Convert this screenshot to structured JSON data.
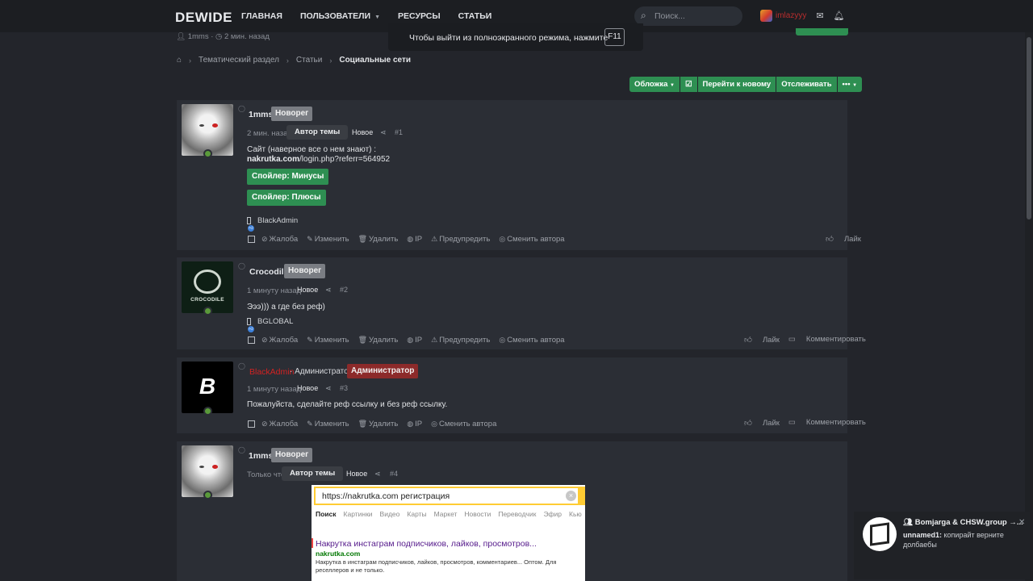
{
  "app": {
    "logo": "DEWIDE"
  },
  "nav": {
    "items": [
      "ГЛАВНАЯ",
      "ПОЛЬЗОВАТЕЛИ",
      "РЕСУРСЫ",
      "СТАТЬИ"
    ],
    "search_placeholder": "Поиск..."
  },
  "user": {
    "name": "imlazyyy"
  },
  "fullscreen_toast": {
    "text": "Чтобы выйти из полноэкранного режима, нажмите",
    "key": "F11"
  },
  "thread_meta": {
    "author": "1mms",
    "time": "2 мин. назад"
  },
  "breadcrumb": [
    "Тематический раздел",
    "Статьи",
    "Социальные сети"
  ],
  "thread_actions": [
    "Обложка",
    "☑",
    "Перейти к новому",
    "Отслеживать",
    "•••"
  ],
  "posts": [
    {
      "username": "1mms",
      "badge": "Новорег",
      "time": "2 мин. назад",
      "tooltip": "Автор темы",
      "new_label": "Новое",
      "num": "#1",
      "text1": "Сайт (наверное все о нем знают) :",
      "link_domain": "nakrutka.com",
      "link_path": "/login.php?referr=564952",
      "spoiler1": "Спойлер: Минусы",
      "spoiler2": "Спойлер: Плюсы",
      "liked_by": "BlackAdmin",
      "footer": [
        "Жалоба",
        "Изменить",
        "Удалить",
        "IP",
        "Предупредить",
        "Сменить автора"
      ],
      "right": [
        "Лайк"
      ]
    },
    {
      "username": "Crocodile",
      "badge": "Новорег",
      "avatar_label": "CROCODILE",
      "time": "1 минуту назад",
      "new_label": "Новое",
      "num": "#2",
      "text1": "Эээ))) а где без реф)",
      "liked_by": "BGLOBAL",
      "footer": [
        "Жалоба",
        "Изменить",
        "Удалить",
        "IP",
        "Предупредить",
        "Сменить автора"
      ],
      "right": [
        "Лайк",
        "Комментировать"
      ]
    },
    {
      "username": "BlackAdmin",
      "role": " · Администратор",
      "badge": "Администратор",
      "time": "1 минуту назад",
      "new_label": "Новое",
      "num": "#3",
      "text1": "Пожалуйста, сделайте реф ссылку и без реф ссылку.",
      "footer": [
        "Жалоба",
        "Изменить",
        "Удалить",
        "IP",
        "Сменить автора"
      ],
      "right": [
        "Лайк",
        "Комментировать"
      ]
    },
    {
      "username": "1mms",
      "badge": "Новорег",
      "time": "Только что",
      "tooltip": "Автор темы",
      "new_label": "Новое",
      "num": "#4"
    }
  ],
  "embedded_search": {
    "query": "https://nakrutka.com регистрация",
    "tabs": [
      "Поиск",
      "Картинки",
      "Видео",
      "Карты",
      "Маркет",
      "Новости",
      "Переводчик",
      "Эфир",
      "Кью"
    ],
    "result_title": "Накрутка инстаграм подписчиков, лайков, просмотров...",
    "result_url": "nakrutka.com",
    "result_desc": "Накрутка в инстаграм подписчиков, лайков, просмотров, комментариев... Оптом. Для реселлеров и не только."
  },
  "notification": {
    "title": "Bomjarga & CHSW.group →...",
    "sender": "unnamed1:",
    "message": " копирайт верните долбаебы"
  },
  "colors": {
    "accent_green": "#2e8f52",
    "admin_red": "#d32222",
    "bg": "#23252b",
    "card": "#2b2e35"
  }
}
